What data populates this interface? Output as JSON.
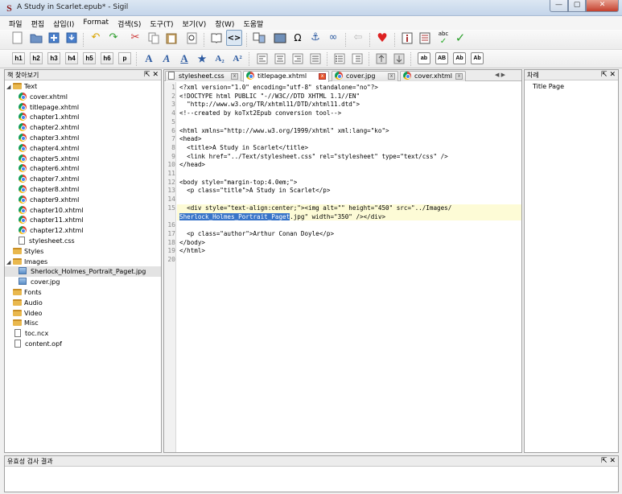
{
  "window": {
    "title": "A Study in Scarlet.epub* - Sigil",
    "app_icon": "S",
    "min_label": "—",
    "max_label": "▢",
    "close_label": "✕"
  },
  "menu": [
    "파일",
    "편집",
    "삽입(I)",
    "Format",
    "검색(S)",
    "도구(T)",
    "보기(V)",
    "창(W)",
    "도움말"
  ],
  "toolbar2": {
    "headings": [
      "h1",
      "h2",
      "h3",
      "h4",
      "h5",
      "h6",
      "p"
    ],
    "format_glyphs": [
      "A",
      "A",
      "A",
      "★",
      "A₂",
      "A²"
    ],
    "case_buttons": [
      "ab",
      "AB",
      "Ab",
      "Ab"
    ]
  },
  "book_browser": {
    "title": "책 찾아보기",
    "ctrls": "⇱ ✕",
    "items": [
      {
        "label": "Text",
        "kind": "folder",
        "level": 0,
        "arrow": "◢"
      },
      {
        "label": "cover.xhtml",
        "kind": "xhtml",
        "level": 1
      },
      {
        "label": "titlepage.xhtml",
        "kind": "xhtml",
        "level": 1
      },
      {
        "label": "chapter1.xhtml",
        "kind": "xhtml",
        "level": 1
      },
      {
        "label": "chapter2.xhtml",
        "kind": "xhtml",
        "level": 1
      },
      {
        "label": "chapter3.xhtml",
        "kind": "xhtml",
        "level": 1
      },
      {
        "label": "chapter4.xhtml",
        "kind": "xhtml",
        "level": 1
      },
      {
        "label": "chapter5.xhtml",
        "kind": "xhtml",
        "level": 1
      },
      {
        "label": "chapter6.xhtml",
        "kind": "xhtml",
        "level": 1
      },
      {
        "label": "chapter7.xhtml",
        "kind": "xhtml",
        "level": 1
      },
      {
        "label": "chapter8.xhtml",
        "kind": "xhtml",
        "level": 1
      },
      {
        "label": "chapter9.xhtml",
        "kind": "xhtml",
        "level": 1
      },
      {
        "label": "chapter10.xhtml",
        "kind": "xhtml",
        "level": 1
      },
      {
        "label": "chapter11.xhtml",
        "kind": "xhtml",
        "level": 1
      },
      {
        "label": "chapter12.xhtml",
        "kind": "xhtml",
        "level": 1
      },
      {
        "label": "stylesheet.css",
        "kind": "css",
        "level": 1
      },
      {
        "label": "Styles",
        "kind": "folder",
        "level": 0,
        "arrow": ""
      },
      {
        "label": "Images",
        "kind": "folder",
        "level": 0,
        "arrow": "◢"
      },
      {
        "label": "Sherlock_Holmes_Portrait_Paget.jpg",
        "kind": "image",
        "level": 1,
        "selected": true
      },
      {
        "label": "cover.jpg",
        "kind": "image",
        "level": 1
      },
      {
        "label": "Fonts",
        "kind": "folder",
        "level": 0,
        "arrow": ""
      },
      {
        "label": "Audio",
        "kind": "folder",
        "level": 0,
        "arrow": ""
      },
      {
        "label": "Video",
        "kind": "folder",
        "level": 0,
        "arrow": ""
      },
      {
        "label": "Misc",
        "kind": "folder",
        "level": 0,
        "arrow": ""
      },
      {
        "label": "toc.ncx",
        "kind": "file",
        "level": 0
      },
      {
        "label": "content.opf",
        "kind": "file",
        "level": 0
      }
    ]
  },
  "tabs": [
    {
      "label": "stylesheet.css",
      "active": false
    },
    {
      "label": "titlepage.xhtml",
      "active": true
    },
    {
      "label": "cover.jpg",
      "active": false
    },
    {
      "label": "cover.xhtml",
      "active": false
    }
  ],
  "tab_nav": "◀ ▶",
  "code_lines": [
    "<?xml version=\"1.0\" encoding=\"utf-8\" standalone=\"no\"?>",
    "<!DOCTYPE html PUBLIC \"-//W3C//DTD XHTML 1.1//EN\"",
    "  \"http://www.w3.org/TR/xhtml11/DTD/xhtml11.dtd\">",
    "<!--created by koTxt2Epub conversion tool-->",
    "",
    "<html xmlns=\"http://www.w3.org/1999/xhtml\" xml:lang=\"ko\">",
    "<head>",
    "  <title>A Study in Scarlet</title>",
    "  <link href=\"../Text/stylesheet.css\" rel=\"stylesheet\" type=\"text/css\" />",
    "</head>",
    "",
    "<body style=\"margin-top:4.0em;\">",
    "  <p class=\"title\">A Study in Scarlet</p>",
    "",
    "  <div style=\"text-align:center;\"><img alt=\"\" height=\"450\" src=\"../Images/",
    "",
    "  <p class=\"author\">Arthur Conan Doyle</p>",
    "</body>",
    "</html>",
    ""
  ],
  "code_wrap": {
    "selected": "Sherlock_Holmes_Portrait_Paget",
    "rest": ".jpg\" width=\"350\" /></div>"
  },
  "toc": {
    "title": "차례",
    "ctrls": "⇱ ✕",
    "items": [
      "Title Page"
    ]
  },
  "validation": {
    "title": "유효성 검사 결과",
    "ctrls": "⇱ ✕"
  }
}
